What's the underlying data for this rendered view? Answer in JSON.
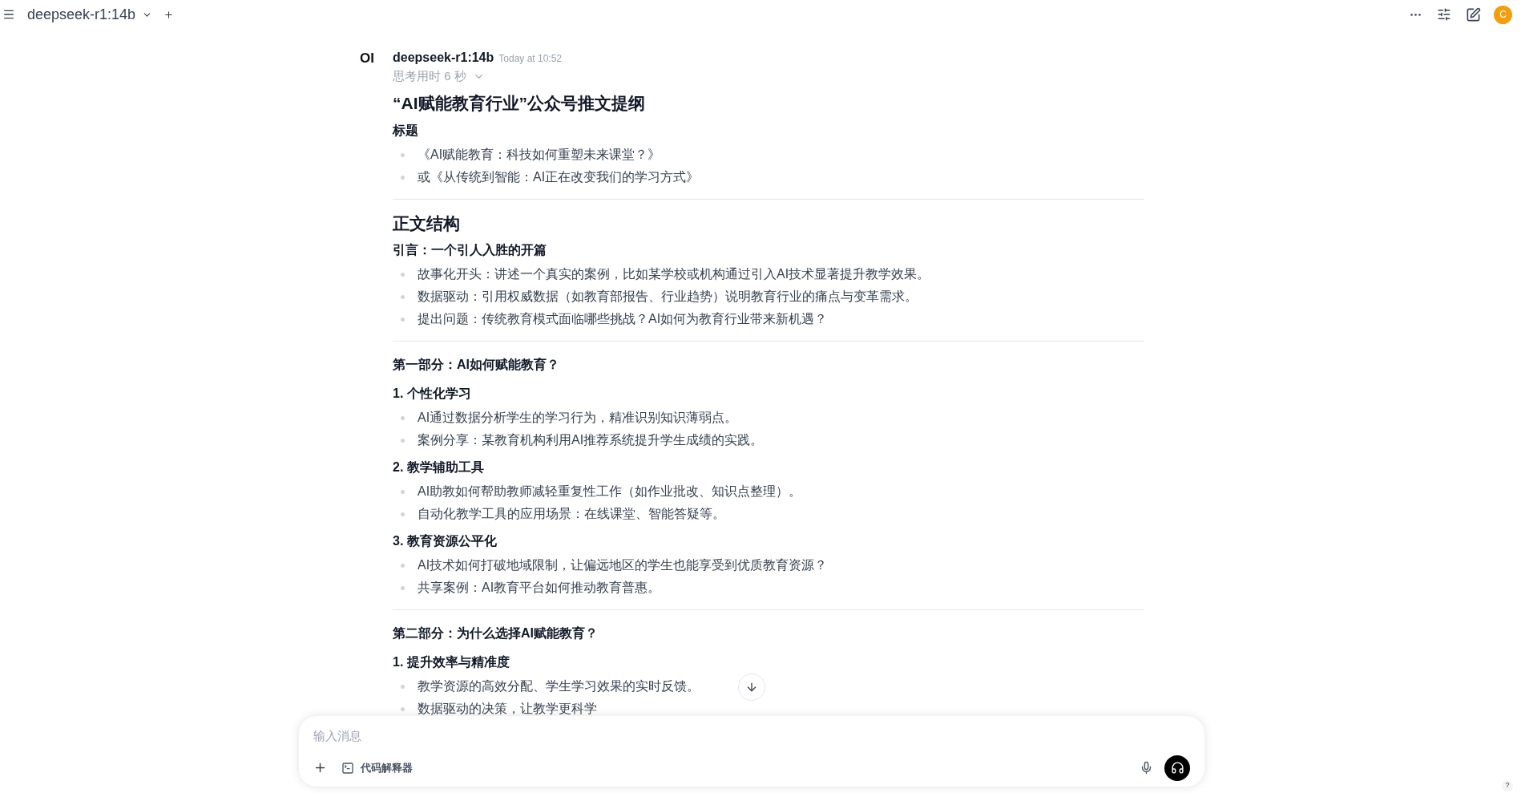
{
  "top_bar": {
    "model": "deepseek-r1:14b",
    "avatar": "C"
  },
  "message": {
    "avatar": "OI",
    "sender": "deepseek-r1:14b",
    "time": "Today at 10:52",
    "thinking": "思考用时 6 秒",
    "thinking_expanded": false,
    "blocks": [
      {
        "kind": "h1",
        "text": "“AI赋能教育行业”公众号推文提纲"
      },
      {
        "kind": "h3",
        "text": "标题"
      },
      {
        "kind": "bullet",
        "text": "《AI赋能教育：科技如何重塑未来课堂？》"
      },
      {
        "kind": "bullet",
        "text": "或《从传统到智能：AI正在改变我们的学习方式》"
      },
      {
        "kind": "hr"
      },
      {
        "kind": "h2",
        "text": "正文结构"
      },
      {
        "kind": "h3",
        "text": "引言：一个引人入胜的开篇"
      },
      {
        "kind": "bullet",
        "text": "故事化开头：讲述一个真实的案例，比如某学校或机构通过引入AI技术显著提升教学效果。"
      },
      {
        "kind": "bullet",
        "text": "数据驱动：引用权威数据（如教育部报告、行业趋势）说明教育行业的痛点与变革需求。"
      },
      {
        "kind": "bullet",
        "text": "提出问题：传统教育模式面临哪些挑战？AI如何为教育行业带来新机遇？"
      },
      {
        "kind": "hr"
      },
      {
        "kind": "h3",
        "text": "第一部分：AI如何赋能教育？"
      },
      {
        "kind": "h4",
        "text": "1. 个性化学习"
      },
      {
        "kind": "bullet",
        "text": "AI通过数据分析学生的学习行为，精准识别知识薄弱点。"
      },
      {
        "kind": "bullet",
        "text": "案例分享：某教育机构利用AI推荐系统提升学生成绩的实践。"
      },
      {
        "kind": "h4",
        "text": "2. 教学辅助工具"
      },
      {
        "kind": "bullet",
        "text": "AI助教如何帮助教师减轻重复性工作（如作业批改、知识点整理）。"
      },
      {
        "kind": "bullet",
        "text": "自动化教学工具的应用场景：在线课堂、智能答疑等。"
      },
      {
        "kind": "h4",
        "text": "3. 教育资源公平化"
      },
      {
        "kind": "bullet",
        "text": "AI技术如何打破地域限制，让偏远地区的学生也能享受到优质教育资源？"
      },
      {
        "kind": "bullet",
        "text": "共享案例：AI教育平台如何推动教育普惠。"
      },
      {
        "kind": "hr"
      },
      {
        "kind": "h3",
        "text": "第二部分：为什么选择AI赋能教育？"
      },
      {
        "kind": "h4",
        "text": "1. 提升效率与精准度"
      },
      {
        "kind": "bullet",
        "text": "教学资源的高效分配、学生学习效果的实时反馈。"
      },
      {
        "kind": "bullet",
        "text": "数据驱动的决策，让教学更科学"
      }
    ]
  },
  "composer": {
    "placeholder": "输入消息",
    "tool": "代码解释器"
  },
  "help": "?"
}
